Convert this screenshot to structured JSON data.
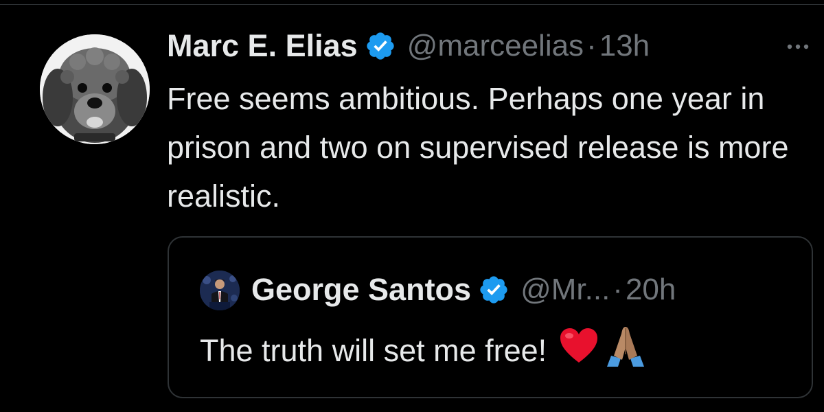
{
  "tweet": {
    "author": {
      "display_name": "Marc E. Elias",
      "handle": "@marceelias",
      "verified": true,
      "avatar": "dog-avatar"
    },
    "separator": "·",
    "time": "13h",
    "more_icon": "more-horizontal-icon",
    "text": "Free seems ambitious. Perhaps one year in prison and two on supervised release is more realistic."
  },
  "quoted_tweet": {
    "author": {
      "display_name": "George Santos",
      "handle": "@Mr...",
      "verified": true,
      "avatar": "person-at-podium-avatar"
    },
    "separator": "·",
    "time": "20h",
    "text": "The truth will set me free!",
    "emojis": [
      "heart-icon",
      "folded-hands-icon"
    ]
  },
  "colors": {
    "background": "#000000",
    "text_primary": "#e7e9ea",
    "text_secondary": "#71767b",
    "verified_badge": "#1d9bf0",
    "border": "#2f3336",
    "heart": "#e8112d"
  }
}
